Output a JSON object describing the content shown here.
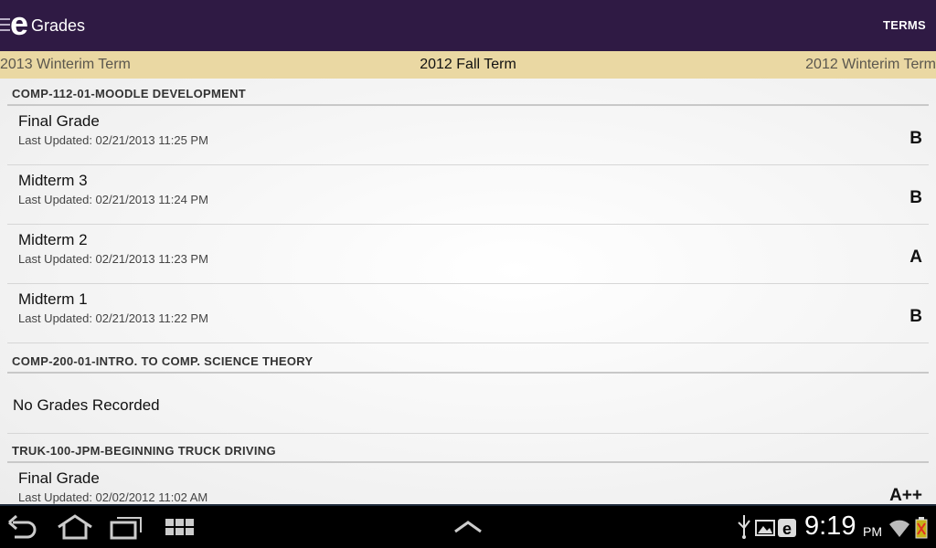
{
  "app": {
    "title": "Grades",
    "logo_letter": "e",
    "terms_button": "TERMS"
  },
  "terms": {
    "previous": "2013 Winterim Term",
    "current": "2012 Fall Term",
    "next": "2012 Winterim Term"
  },
  "courses": [
    {
      "name": "COMP-112-01-MOODLE DEVELOPMENT",
      "grades": [
        {
          "item": "Final Grade",
          "updated": "Last Updated: 02/21/2013 11:25 PM",
          "grade": "B"
        },
        {
          "item": "Midterm 3",
          "updated": "Last Updated: 02/21/2013 11:24 PM",
          "grade": "B"
        },
        {
          "item": "Midterm 2",
          "updated": "Last Updated: 02/21/2013 11:23 PM",
          "grade": "A"
        },
        {
          "item": "Midterm 1",
          "updated": "Last Updated: 02/21/2013 11:22 PM",
          "grade": "B"
        }
      ]
    },
    {
      "name": "COMP-200-01-INTRO. TO COMP. SCIENCE THEORY",
      "empty_message": "No Grades Recorded"
    },
    {
      "name": "TRUK-100-JPM-BEGINNING TRUCK DRIVING",
      "grades": [
        {
          "item": "Final Grade",
          "updated": "Last Updated: 02/02/2012 11:02 AM",
          "grade": "A++"
        }
      ]
    }
  ],
  "system_bar": {
    "time": "9:19",
    "ampm": "PM",
    "icons": [
      "back-icon",
      "home-icon",
      "recent-apps-icon",
      "app-grid-icon",
      "chevron-up-icon",
      "usb-icon",
      "gallery-icon",
      "app-e-icon",
      "wifi-icon",
      "battery-icon"
    ]
  },
  "colors": {
    "appbar": "#2f1a44",
    "termbar": "#ead8a3",
    "navbar": "#000000"
  }
}
